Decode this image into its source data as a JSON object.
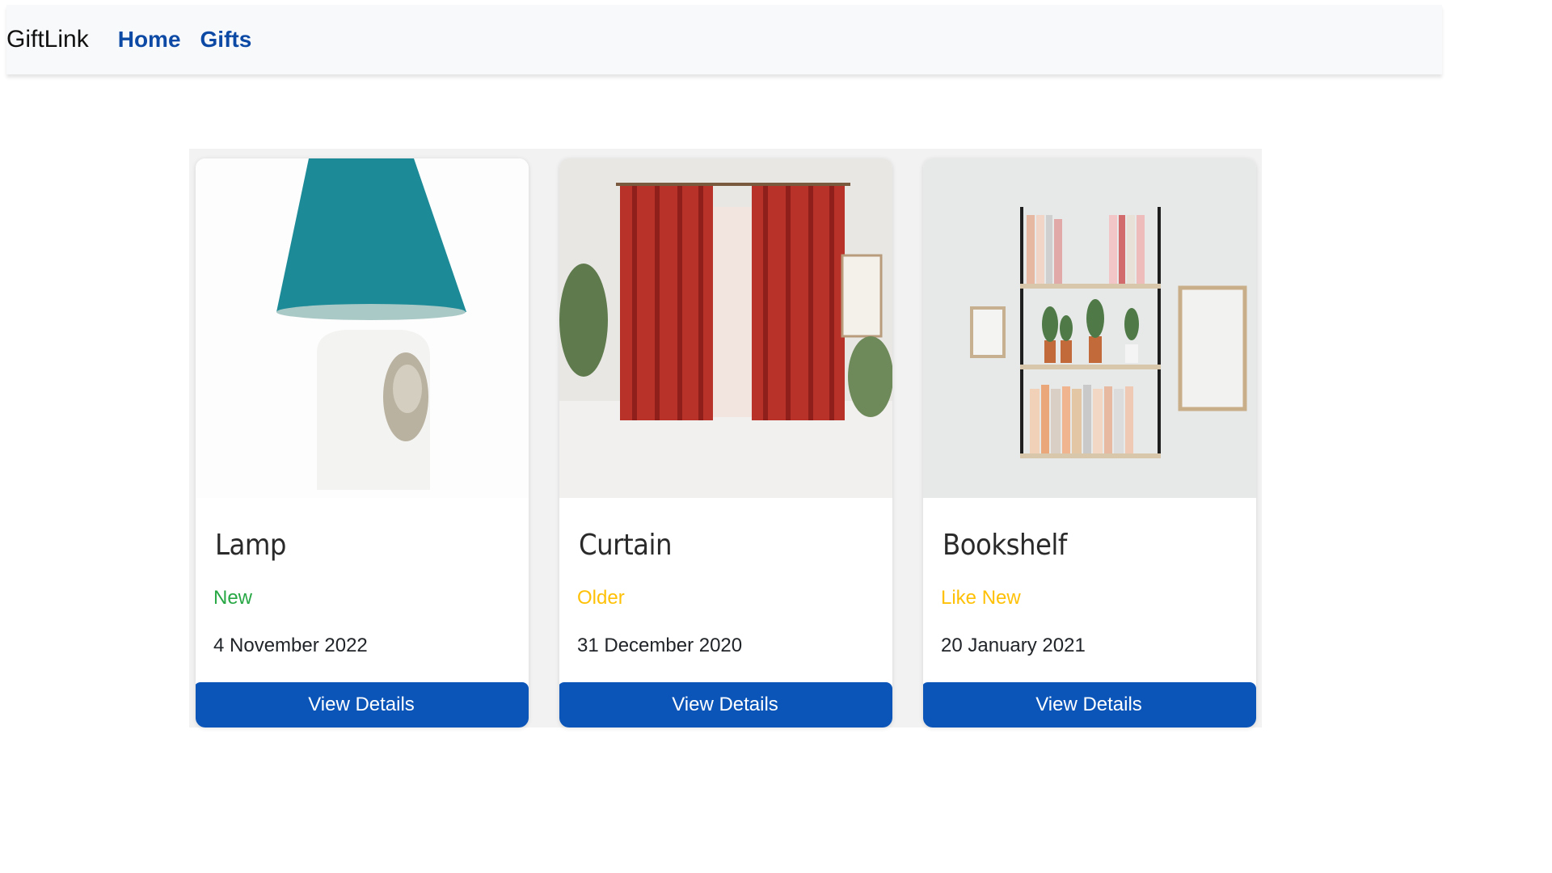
{
  "navbar": {
    "brand": "GiftLink",
    "links": [
      {
        "label": "Home"
      },
      {
        "label": "Gifts"
      }
    ]
  },
  "gifts": [
    {
      "name": "Lamp",
      "condition": "New",
      "condition_color": "#28a745",
      "date": "4 November 2022",
      "button": "View Details"
    },
    {
      "name": "Curtain",
      "condition": "Older",
      "condition_color": "#ffc107",
      "date": "31 December 2020",
      "button": "View Details"
    },
    {
      "name": "Bookshelf",
      "condition": "Like New",
      "condition_color": "#ffc107",
      "date": "20 January 2021",
      "button": "View Details"
    }
  ],
  "colors": {
    "primary": "#0b55b8",
    "nav_link": "#0d4aa6",
    "navbar_bg": "#f8f9fa"
  }
}
